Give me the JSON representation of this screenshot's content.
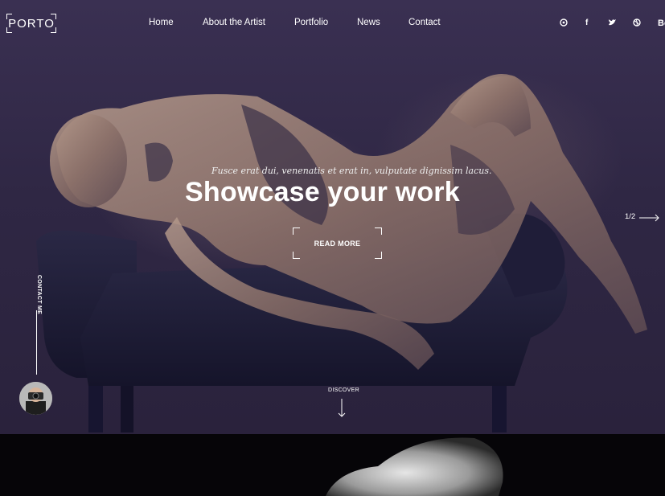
{
  "brand": {
    "logo_text": "PORTO"
  },
  "nav": {
    "items": [
      {
        "label": "Home"
      },
      {
        "label": "About the Artist"
      },
      {
        "label": "Portfolio"
      },
      {
        "label": "News"
      },
      {
        "label": "Contact"
      }
    ]
  },
  "social": {
    "icons": [
      {
        "name": "pinterest-icon",
        "glyph": "℗"
      },
      {
        "name": "facebook-icon",
        "glyph": "f"
      },
      {
        "name": "twitter-icon",
        "glyph": "🐦"
      },
      {
        "name": "dribbble-icon",
        "glyph": "⊛"
      }
    ]
  },
  "header_cta": {
    "label": "Bo"
  },
  "hero": {
    "tagline": "Fusce erat dui, venenatis et erat in, vulputate dignissim lacus.",
    "headline": "Showcase your work",
    "read_more_label": "READ MORE",
    "pager": "1/2",
    "contact_label": "CONTACT ME",
    "discover_label": "DISCOVER"
  },
  "colors": {
    "hero_background": "#2f2744",
    "text": "#ffffff",
    "bottom_background": "#060508"
  }
}
